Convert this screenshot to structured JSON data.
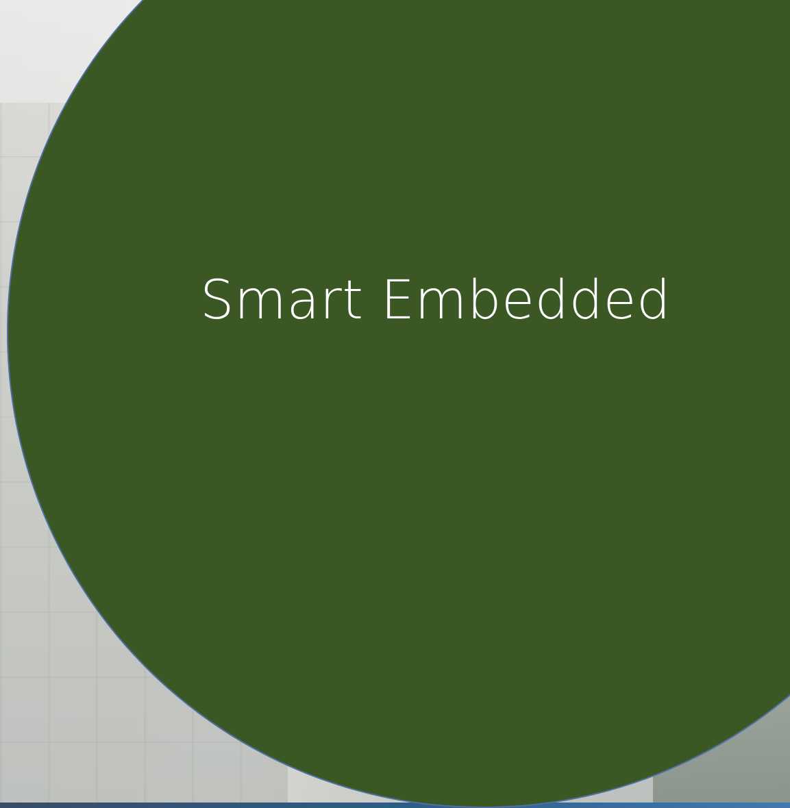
{
  "slide": {
    "title": "Smart Embedded",
    "colors": {
      "circle_fill": "#3b5724",
      "circle_outline": "#4f6fa3",
      "title_text": "#ffffff"
    }
  }
}
